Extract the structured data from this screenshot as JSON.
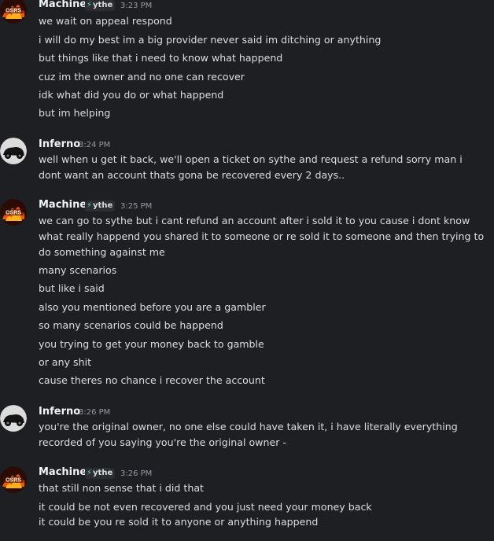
{
  "users": {
    "machine": {
      "name": "Machine",
      "tag": "ythe",
      "avatar_text": "OSRS"
    },
    "inferno": {
      "name": "Inferno"
    }
  },
  "groups": [
    {
      "user": "Machine",
      "time": "3:23 PM",
      "messages": [
        "we wait on appeal respond",
        "i will do my best im a big provider never said im ditching or anything",
        "but things like that i need to know what happend",
        "cuz im the owner and no one can recover",
        "idk what did you do or what happend",
        "but im helping"
      ]
    },
    {
      "user": "Inferno",
      "time": "3:24 PM",
      "messages": [
        "well when u get it back, we'll open a ticket on sythe and request a refund sorry man i dont want an account thats gona be recovered every 2 days.."
      ]
    },
    {
      "user": "Machine",
      "time": "3:25 PM",
      "messages": [
        "we can go to sythe but i cant refund an account after i sold it to you cause i dont know what really happend you shared it to someone or re sold it to someone and then trying to do something against me",
        "many scenarios",
        "but like i said",
        "also you mentioned before you are a gambler",
        "so many scenarios could be happend",
        "you trying to get your money back to gamble",
        "or any shit",
        "cause theres no chance i recover the account"
      ]
    },
    {
      "user": "Inferno",
      "time": "3:26 PM",
      "messages": [
        "you're the original owner, no one else could have taken it, i have literally everything recorded of you saying you're the original owner -"
      ]
    },
    {
      "user": "Machine",
      "time": "3:26 PM",
      "messages": [
        "that still non sense that i did that",
        "it could be not even recovered and you just need your money back",
        "it could be you re sold it to anyone or anything happend"
      ]
    }
  ],
  "colors": {
    "background": "#1e1f22",
    "username": "#f2f3f5",
    "text": "#dbdee1",
    "timestamp": "#949ba4",
    "tag_bolt": "#5fd1c6"
  },
  "icons": {
    "tag": "lightning-bolt-icon",
    "machine_avatar": "osrs-fire-avatar",
    "inferno_avatar": "black-car-avatar"
  }
}
